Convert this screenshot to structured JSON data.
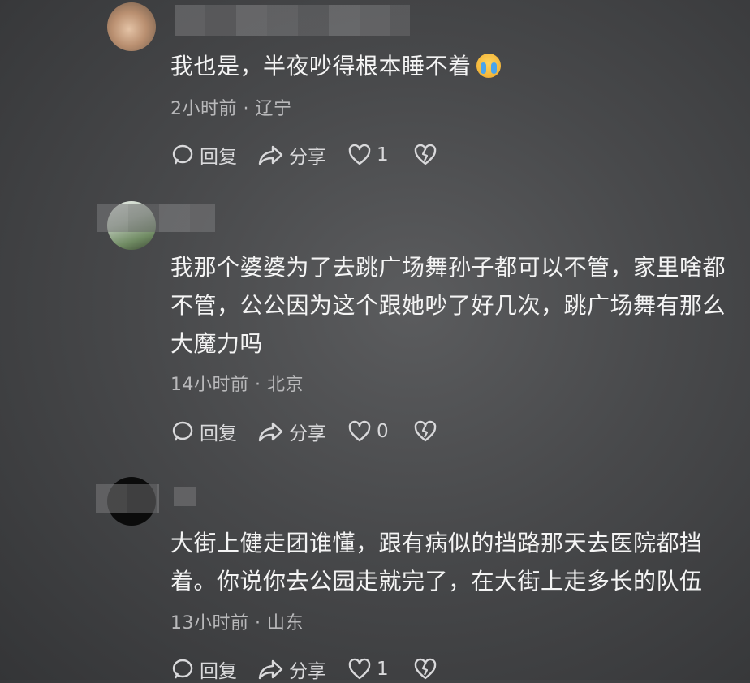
{
  "comments": [
    {
      "text": "我也是，半夜吵得根本睡不着",
      "emoji": "crying-face",
      "time": "2小时前",
      "location": "辽宁",
      "reply_label": "回复",
      "share_label": "分享",
      "likes": "1"
    },
    {
      "text": "我那个婆婆为了去跳广场舞孙子都可以不管，家里啥都不管，公公因为这个跟她吵了好几次，跳广场舞有那么大魔力吗",
      "time": "14小时前",
      "location": "北京",
      "reply_label": "回复",
      "share_label": "分享",
      "likes": "0"
    },
    {
      "text": "大街上健走团谁懂，跟有病似的挡路那天去医院都挡着。你说你去公园走就完了，在大街上走多长的队伍",
      "time": "13小时前",
      "location": "山东",
      "reply_label": "回复",
      "share_label": "分享",
      "likes": "1"
    }
  ],
  "meta_separator": " · ",
  "icons": [
    "comment-bubble-icon",
    "share-arrow-icon",
    "heart-icon",
    "broken-heart-icon"
  ]
}
